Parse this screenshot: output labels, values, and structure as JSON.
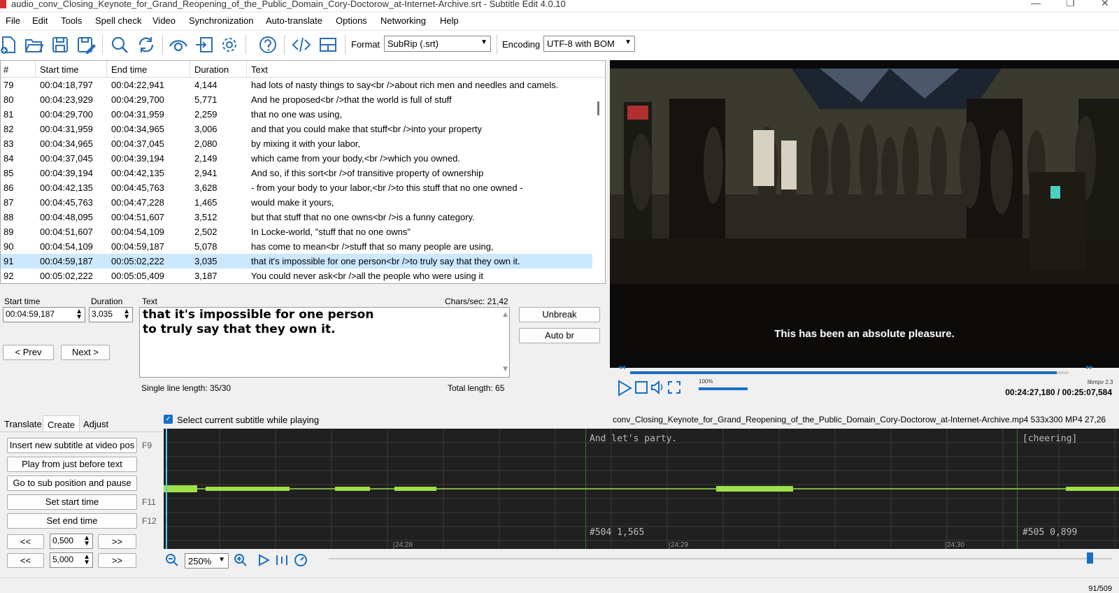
{
  "window": {
    "title": "audio_conv_Closing_Keynote_for_Grand_Reopening_of_the_Public_Domain_Cory-Doctorow_at-Internet-Archive.srt - Subtitle Edit 4.0.10"
  },
  "menu": [
    "File",
    "Edit",
    "Tools",
    "Spell check",
    "Video",
    "Synchronization",
    "Auto-translate",
    "Options",
    "Networking",
    "Help"
  ],
  "toolbar": {
    "format_label": "Format",
    "format_value": "SubRip (.srt)",
    "encoding_label": "Encoding",
    "encoding_value": "UTF-8 with BOM",
    "icons": [
      "new-file-icon",
      "open-folder-icon",
      "save-icon",
      "save-as-icon",
      "find-icon",
      "replace-icon",
      "visual-sync-icon",
      "fix-common-errors-icon",
      "settings-icon",
      "help-icon",
      "source-view-icon",
      "layout-icon"
    ]
  },
  "grid": {
    "headers": [
      "#",
      "Start time",
      "End time",
      "Duration",
      "Text"
    ],
    "rows": [
      [
        "79",
        "00:04:18,797",
        "00:04:22,941",
        "4,144",
        "had lots of nasty things to say<br />about rich men and needles and camels."
      ],
      [
        "80",
        "00:04:23,929",
        "00:04:29,700",
        "5,771",
        "And he proposed<br />that the world is full of stuff"
      ],
      [
        "81",
        "00:04:29,700",
        "00:04:31,959",
        "2,259",
        "that no one was using,"
      ],
      [
        "82",
        "00:04:31,959",
        "00:04:34,965",
        "3,006",
        "and that you could make that stuff<br />into your property"
      ],
      [
        "83",
        "00:04:34,965",
        "00:04:37,045",
        "2,080",
        "by mixing it with your labor,"
      ],
      [
        "84",
        "00:04:37,045",
        "00:04:39,194",
        "2,149",
        "which came from your body,<br />which you owned."
      ],
      [
        "85",
        "00:04:39,194",
        "00:04:42,135",
        "2,941",
        "And so, if this sort<br />of transitive property of ownership"
      ],
      [
        "86",
        "00:04:42,135",
        "00:04:45,763",
        "3,628",
        "- from your body to your labor,<br />to this stuff that no one owned -"
      ],
      [
        "87",
        "00:04:45,763",
        "00:04:47,228",
        "1,465",
        "would make it yours,"
      ],
      [
        "88",
        "00:04:48,095",
        "00:04:51,607",
        "3,512",
        "but that stuff that no one owns<br />is a funny category."
      ],
      [
        "89",
        "00:04:51,607",
        "00:04:54,109",
        "2,502",
        "In Locke-world, \"stuff that no one owns\""
      ],
      [
        "90",
        "00:04:54,109",
        "00:04:59,187",
        "5,078",
        "has come to mean<br />stuff that so many people are using,"
      ],
      [
        "91",
        "00:04:59,187",
        "00:05:02,222",
        "3,035",
        "that it's impossible for one person<br />to truly say that they own it."
      ],
      [
        "92",
        "00:05:02,222",
        "00:05:05,409",
        "3,187",
        "You could never ask<br />all the people who were using it"
      ]
    ],
    "selected_index": 12
  },
  "editor": {
    "start_time_label": "Start time",
    "start_time_value": "00:04:59,187",
    "duration_label": "Duration",
    "duration_value": "3,035",
    "text_label": "Text",
    "chars_sec": "Chars/sec: 21,42",
    "line1": "that it's impossible for one person",
    "line2": "to truly say that they own it.",
    "prev_label": "< Prev",
    "next_label": "Next >",
    "unbreak_label": "Unbreak",
    "auto_br_label": "Auto br",
    "single_line_length": "Single line length: 35/30",
    "total_length": "Total length: 65"
  },
  "video": {
    "subtitle": "This has been an absolute pleasure.",
    "volume": "100%",
    "engine": "libmpv 2.3",
    "time": "00:24:27,180 / 00:25:07,584",
    "progress_fraction": 0.973,
    "volume_fraction": 1.0
  },
  "tabs": [
    "Translate",
    "Create",
    "Adjust"
  ],
  "active_tab": "Create",
  "select_while_playing": "Select current subtitle while playing",
  "file_info": "conv_Closing_Keynote_for_Grand_Reopening_of_the_Public_Domain_Cory-Doctorow_at-Internet-Archive.mp4 533x300 MP4 27,26",
  "create_panel": {
    "insert_label": "Insert new subtitle at video pos",
    "insert_key": "F9",
    "play_before_label": "Play from just before text",
    "goto_label": "Go to sub position and pause",
    "set_start_label": "Set start time",
    "set_start_key": "F11",
    "set_end_label": "Set end time",
    "set_end_key": "F12",
    "back_label": "<<",
    "forward_label": ">>",
    "step1_value": "0,500",
    "step2_value": "5,000"
  },
  "waveform": {
    "caption_left": "And let's party.",
    "caption_right": "[cheering]",
    "info_left": "#504  1,565",
    "info_right": "#505  0,899",
    "tick1": "24:28",
    "tick2": "24:29",
    "tick3": "24:30",
    "zoom_value": "250%"
  },
  "status": {
    "position": "91/509"
  }
}
